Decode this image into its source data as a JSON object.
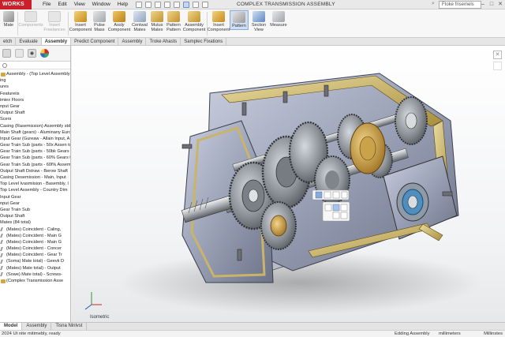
{
  "app": {
    "brand": "WORKS",
    "document_title": "COMPLEX TRANSMISSION ASSEMBLY"
  },
  "menus": [
    "File",
    "Edit",
    "View",
    "Window",
    "Help"
  ],
  "search": {
    "placeholder": "Ftoke fnsemels"
  },
  "window_controls": [
    "–",
    "□",
    "✕"
  ],
  "ribbon": {
    "buttons": [
      {
        "label": "Mate",
        "icon": "mate-icon"
      },
      {
        "label": "Components",
        "icon": "components-icon",
        "dim": true
      },
      {
        "label": "Insert Freelances",
        "icon": "insert-icon",
        "dim": true
      },
      {
        "label": "Insert Component",
        "icon": "insert-component-icon"
      },
      {
        "label": "Pulse Mass",
        "icon": "pulse-icon"
      },
      {
        "label": "Assly Component",
        "icon": "assembly-icon"
      },
      {
        "label": "Centwal Mates",
        "icon": "mates-icon"
      },
      {
        "label": "Mutus Mates",
        "icon": "mutus-icon"
      },
      {
        "label": "Pattern Pattern",
        "icon": "pattern-icon"
      },
      {
        "label": "Assembly Component",
        "icon": "assembly-component-icon"
      },
      {
        "label": "Insert Component",
        "icon": "insert-component2-icon"
      },
      {
        "label": "Pattern",
        "icon": "pattern2-icon",
        "selected": true
      },
      {
        "label": "Section View",
        "icon": "section-view-icon"
      },
      {
        "label": "Measure",
        "icon": "measure-icon"
      }
    ]
  },
  "command_tabs": [
    "etch",
    "Evaluate",
    "Assembly",
    "Predict Component",
    "Assembly",
    "Troke Ahasts",
    "Samplec Fixations"
  ],
  "active_command_tab": "Assembly",
  "tree": {
    "items": [
      {
        "label": "Assembly - (Top Level Assembly -",
        "icon": "asm"
      },
      {
        "label": "ing",
        "icon": ""
      },
      {
        "label": "ures",
        "icon": ""
      },
      {
        "label": "Featureiis",
        "icon": ""
      },
      {
        "label": "imiex Floors",
        "icon": ""
      },
      {
        "label": "nput Gear",
        "icon": ""
      },
      {
        "label": "Output Shaft",
        "icon": ""
      },
      {
        "label": "Scers",
        "icon": ""
      },
      {
        "label": "Casing (Rasemission) Assembly std",
        "icon": ""
      },
      {
        "label": "Main Shaft (gears) - Aluminany Euro",
        "icon": ""
      },
      {
        "label": "Input Gear (Gureaw - Allain Input, A",
        "icon": ""
      },
      {
        "label": "Gear Train Sub (parts - 50x Assen to",
        "icon": ""
      },
      {
        "label": "Gear Train Sub (parts - 50bk Gears to",
        "icon": ""
      },
      {
        "label": "Gear Train Sub (parts - 60% Gears to",
        "icon": ""
      },
      {
        "label": "Gear Train Sub (parts - 60l% Assem",
        "icon": ""
      },
      {
        "label": "Output Shaft Dstraw - Berow Shaft",
        "icon": ""
      },
      {
        "label": "Casing Desemission - Main, Input",
        "icon": ""
      },
      {
        "label": "Top Level Ivasmiision - Basembly, I",
        "icon": ""
      },
      {
        "label": "Top Level Assembly - Country Dim",
        "icon": ""
      },
      {
        "label": "Input Gear",
        "icon": ""
      },
      {
        "label": "nput Gear",
        "icon": ""
      },
      {
        "label": "Gear Train Sub",
        "icon": ""
      },
      {
        "label": "Output Shaft",
        "icon": ""
      },
      {
        "label": "Mates (84 total)",
        "icon": ""
      },
      {
        "label": "(Mates) Coincident - Caling,",
        "icon": "mate"
      },
      {
        "label": "(Mates) Coincident - Main G",
        "icon": "mate"
      },
      {
        "label": "(Mates) Coincident - Main G",
        "icon": "mate"
      },
      {
        "label": "(Mates) Coincident - Concer",
        "icon": "mate"
      },
      {
        "label": "(Mates) Coincident - Gear Tr",
        "icon": "mate"
      },
      {
        "label": "(Soma) Mate total) - Geevk D",
        "icon": "mate"
      },
      {
        "label": "(Mates) Mate total) - Output",
        "icon": "mate"
      },
      {
        "label": "(Sowe) Mate total) - Screws-",
        "icon": "mate"
      },
      {
        "label": "(Complex Transmission Asse",
        "icon": "asm"
      }
    ]
  },
  "viewport": {
    "view_label": "Isometric"
  },
  "bottom_tabs": [
    "Model",
    "Assembly",
    "Tisna Nlnlvst"
  ],
  "active_bottom_tab": "Model",
  "status": {
    "left": "2024 Ut nite mitimebly, ready",
    "mode": "Edding Assembly",
    "units": "millimeters",
    "right": "Millinstes"
  },
  "colors": {
    "brand": "#c9202a",
    "casing": "#9aa1b6",
    "frame": "#c9b46a",
    "gear_metal": "#8a8f95",
    "brass": "#c49a3b"
  }
}
